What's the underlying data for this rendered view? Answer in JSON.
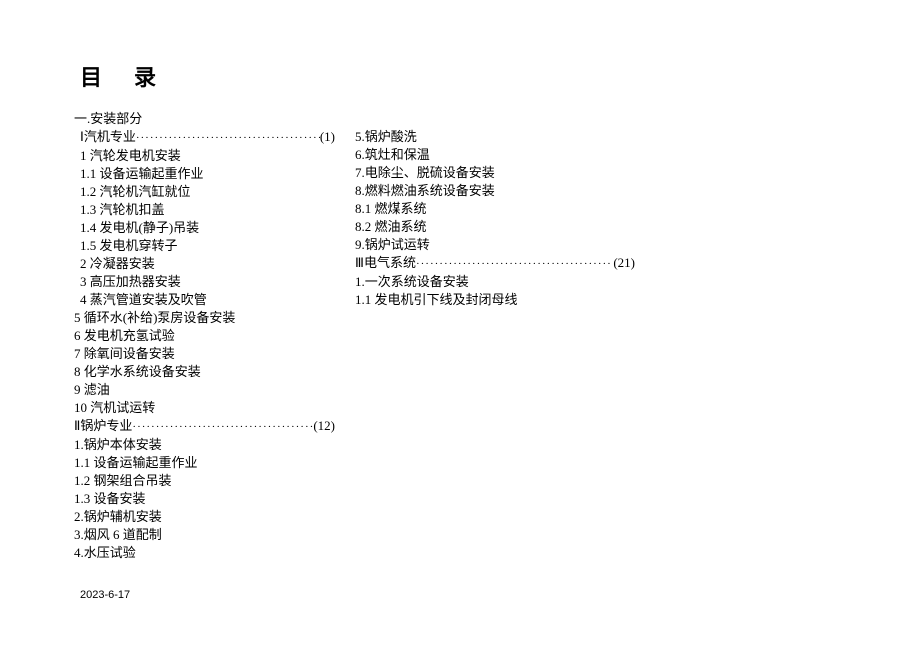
{
  "title": "目录",
  "section_heading": "一.安装部分",
  "left": [
    {
      "text": "Ⅰ汽机专业",
      "page": "(1)"
    },
    {
      "text": "1 汽轮发电机安装"
    },
    {
      "text": "1.1 设备运输起重作业"
    },
    {
      "text": "1.2 汽轮机汽缸就位"
    },
    {
      "text": "1.3 汽轮机扣盖"
    },
    {
      "text": "1.4 发电机(静子)吊装"
    },
    {
      "text": "1.5 发电机穿转子"
    },
    {
      "text": "2 冷凝器安装"
    },
    {
      "text": "3 高压加热器安装"
    },
    {
      "text": "4 蒸汽管道安装及吹管"
    },
    {
      "text": "5 循环水(补给)泵房设备安装",
      "outdent": true
    },
    {
      "text": "6 发电机充氢试验",
      "outdent": true
    },
    {
      "text": "7 除氧间设备安装",
      "outdent": true
    },
    {
      "text": "8 化学水系统设备安装",
      "outdent": true
    },
    {
      "text": "9 滤油",
      "outdent": true
    },
    {
      "text": "10 汽机试运转",
      "outdent": true
    },
    {
      "text": "Ⅱ锅炉专业",
      "page": "(12)",
      "outdent": true
    },
    {
      "text": "1.锅炉本体安装",
      "outdent": true
    },
    {
      "text": "1.1 设备运输起重作业",
      "outdent": true
    },
    {
      "text": "1.2 钢架组合吊装",
      "outdent": true
    },
    {
      "text": "1.3 设备安装",
      "outdent": true
    },
    {
      "text": "2.锅炉辅机安装",
      "outdent": true
    },
    {
      "text": "3.烟风 6 道配制",
      "outdent": true
    },
    {
      "text": "4.水压试验",
      "outdent": true
    }
  ],
  "right": [
    {
      "text": "5.锅炉酸洗"
    },
    {
      "text": "6.筑灶和保温"
    },
    {
      "text": "7.电除尘、脱硫设备安装"
    },
    {
      "text": "8.燃料燃油系统设备安装"
    },
    {
      "text": "8.1 燃煤系统"
    },
    {
      "text": "8.2 燃油系统"
    },
    {
      "text": "9.锅炉试运转"
    },
    {
      "text": "Ⅲ电气系统",
      "page": "(21)"
    },
    {
      "text": "1.一次系统设备安装"
    },
    {
      "text": "1.1 发电机引下线及封闭母线"
    }
  ],
  "footer_date": "2023-6-17"
}
